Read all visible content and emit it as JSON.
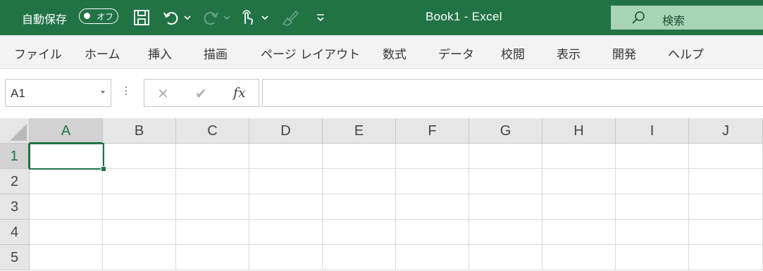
{
  "titlebar": {
    "autosave_label": "自動保存",
    "autosave_state": "オフ",
    "title": "Book1  -  Excel",
    "search_label": "検索",
    "colors": {
      "bar": "#217346",
      "search_bg": "#a7d4b5"
    },
    "quick_access_icons": [
      "save-icon",
      "undo-icon",
      "redo-icon",
      "touch-mode-icon",
      "format-painter-icon",
      "customize-qat-icon"
    ]
  },
  "ribbon": {
    "tabs": [
      "ファイル",
      "ホーム",
      "挿入",
      "描画",
      "ページ レイアウト",
      "数式",
      "データ",
      "校閲",
      "表示",
      "開発",
      "ヘルプ"
    ]
  },
  "formula_bar": {
    "name_box": "A1",
    "cancel_symbol": "✕",
    "enter_symbol": "✔",
    "fx_label": "fx",
    "formula": ""
  },
  "grid": {
    "columns": [
      "A",
      "B",
      "C",
      "D",
      "E",
      "F",
      "G",
      "H",
      "I",
      "J"
    ],
    "rows": [
      "1",
      "2",
      "3",
      "4",
      "5"
    ],
    "active_cell": "A1"
  }
}
